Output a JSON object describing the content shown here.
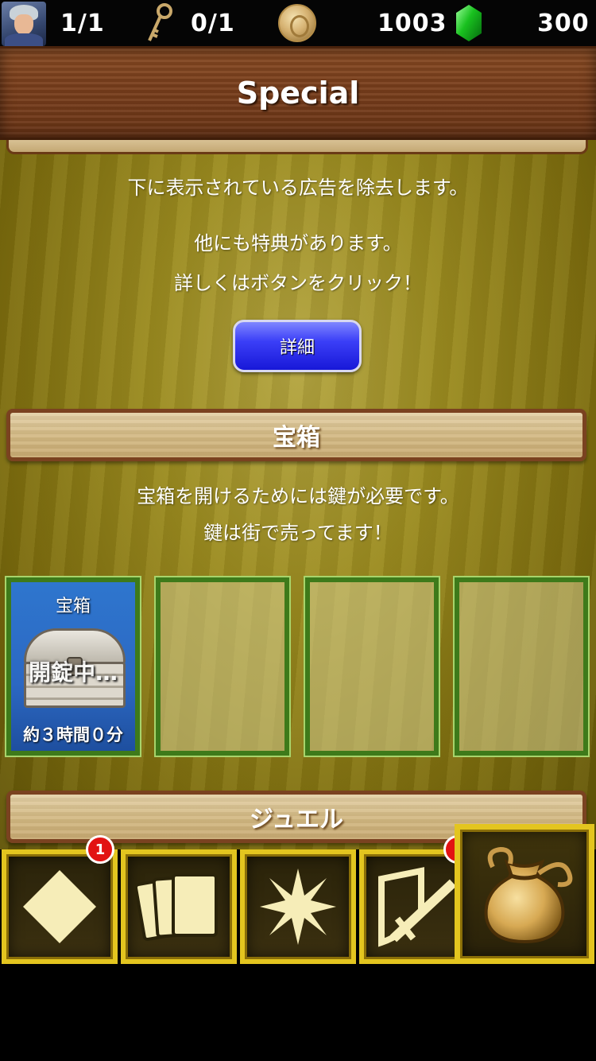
{
  "status_bar": {
    "stamina": "1/1",
    "keys": "0/1",
    "coins": "1003",
    "gems": "300"
  },
  "header": {
    "title": "Special"
  },
  "special": {
    "line1": "下に表示されている広告を除去します。",
    "line2": "他にも特典があります。",
    "line3": "詳しくはボタンをクリック！",
    "detail_button": "詳細"
  },
  "treasure": {
    "section_title": "宝箱",
    "line1": "宝箱を開けるためには鍵が必要です。",
    "line2": "鍵は街で売ってます！",
    "slots": [
      {
        "label": "宝箱",
        "status": "開錠中…",
        "timer": "約３時間０分"
      }
    ]
  },
  "jewel": {
    "section_title": "ジュエル"
  },
  "tabs": {
    "badge_count": "1",
    "icons": [
      "diamond-icon",
      "cards-icon",
      "burst-icon",
      "equipment-icon",
      "bag-icon"
    ],
    "colors": {
      "accent": "#e3c51f",
      "badge": "#e21313"
    }
  }
}
